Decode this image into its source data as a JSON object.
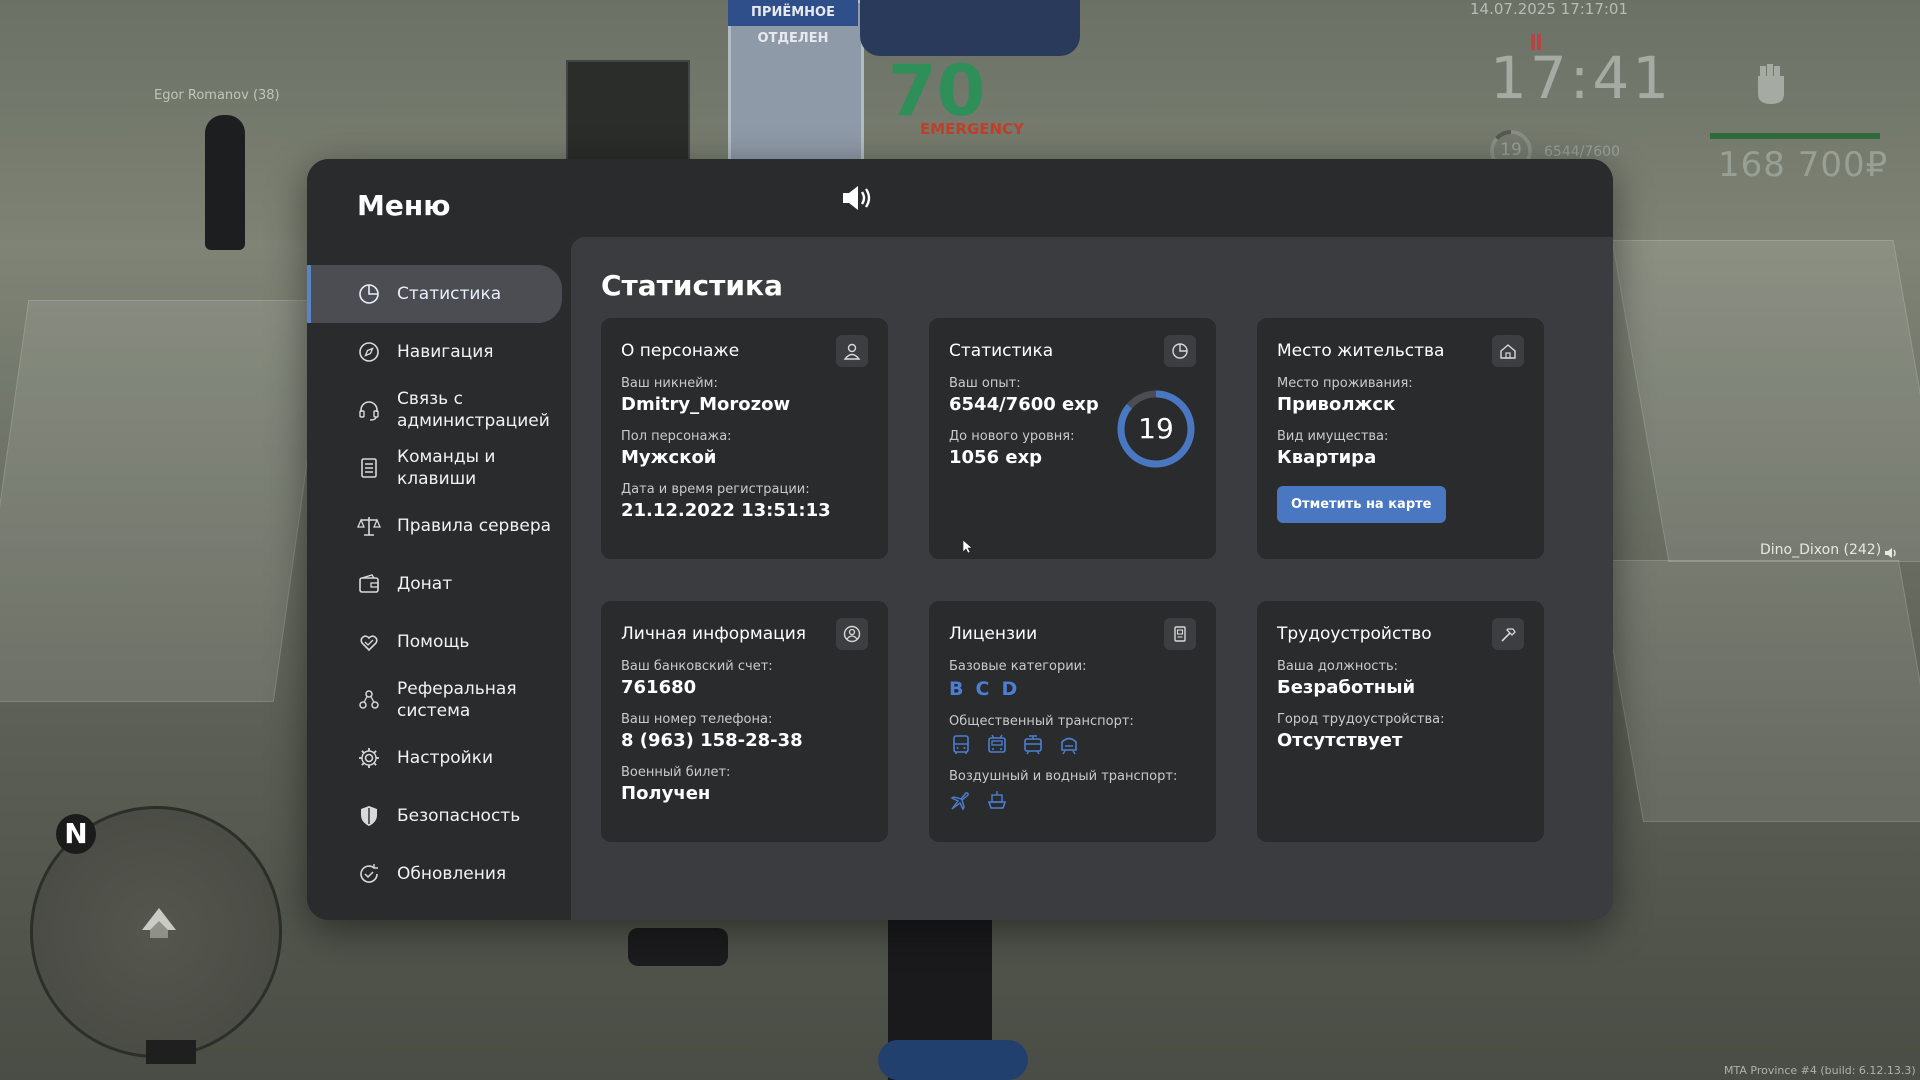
{
  "game_hud": {
    "npc_name": "Egor Romanov (38)",
    "date_time": "14.07.2025 17:17:01",
    "clock": "17:41",
    "level": "19",
    "exp": "6544/7600",
    "money": "168 700₽",
    "voice_player": "Dino_Dixon (242)",
    "build": "MTA Province #4 (build: 6.12.13.3)",
    "minimap_north": "N",
    "bg_sign": "ПРИЁМНОЕ ОТДЕЛЕН",
    "bg_emergency": "EMERGENCY",
    "bg_number": "70"
  },
  "menu": {
    "title": "Меню",
    "sound_icon": "speaker-icon",
    "close_icon": "close-icon",
    "nav": [
      {
        "label": "Статистика",
        "icon": "pie-chart-icon",
        "active": true
      },
      {
        "label": "Навигация",
        "icon": "compass-icon"
      },
      {
        "label": "Связь с администрацией",
        "icon": "headset-icon"
      },
      {
        "label": "Команды и клавиши",
        "icon": "document-list-icon"
      },
      {
        "label": "Правила сервера",
        "icon": "scales-icon"
      },
      {
        "label": "Донат",
        "icon": "wallet-icon"
      },
      {
        "label": "Помощь",
        "icon": "heart-hand-icon"
      },
      {
        "label": "Реферальная система",
        "icon": "referral-icon"
      },
      {
        "label": "Настройки",
        "icon": "gear-icon"
      },
      {
        "label": "Безопасность",
        "icon": "shield-icon"
      },
      {
        "label": "Обновления",
        "icon": "refresh-check-icon"
      }
    ]
  },
  "stats": {
    "section_title": "Статистика",
    "character": {
      "title": "О персонаже",
      "icon": "user-icon",
      "nickname_label": "Ваш никнейм:",
      "nickname": "Dmitry_Morozow",
      "gender_label": "Пол персонажа:",
      "gender": "Мужской",
      "reg_label": "Дата и время регистрации:",
      "reg": "21.12.2022 13:51:13"
    },
    "statistics": {
      "title": "Статистика",
      "icon": "pie-chart-icon",
      "exp_label": "Ваш опыт:",
      "exp": "6544/7600 exp",
      "next_label": "До нового уровня:",
      "next": "1056 exp",
      "level": "19",
      "level_progress": 0.861,
      "ring_color": "#4a77c2"
    },
    "residence": {
      "title": "Место жительства",
      "icon": "house-icon",
      "place_label": "Место проживания:",
      "place": "Приволжск",
      "property_label": "Вид имущества:",
      "property": "Квартира",
      "map_button": "Отметить на карте"
    },
    "personal": {
      "title": "Личная информация",
      "icon": "user-circle-icon",
      "bank_label": "Ваш банковский счет:",
      "bank": "761680",
      "phone_label": "Ваш номер телефона:",
      "phone": "8 (963) 158-28-38",
      "military_label": "Военный билет:",
      "military": "Получен"
    },
    "licenses": {
      "title": "Лицензии",
      "icon": "license-icon",
      "base_label": "Базовые категории:",
      "categories": [
        "B",
        "C",
        "D"
      ],
      "public_label": "Общественный транспорт:",
      "public_icons": [
        "bus-icon",
        "trolleybus-icon",
        "tram-icon",
        "metro-icon"
      ],
      "air_label": "Воздушный и водный транспорт:",
      "air_icons": [
        "plane-icon",
        "boat-icon"
      ],
      "accent": "#4c7fd3"
    },
    "employment": {
      "title": "Трудоустройство",
      "icon": "hammer-icon",
      "position_label": "Ваша должность:",
      "position": "Безработный",
      "city_label": "Город трудоустройства:",
      "city": "Отсутствует"
    }
  }
}
